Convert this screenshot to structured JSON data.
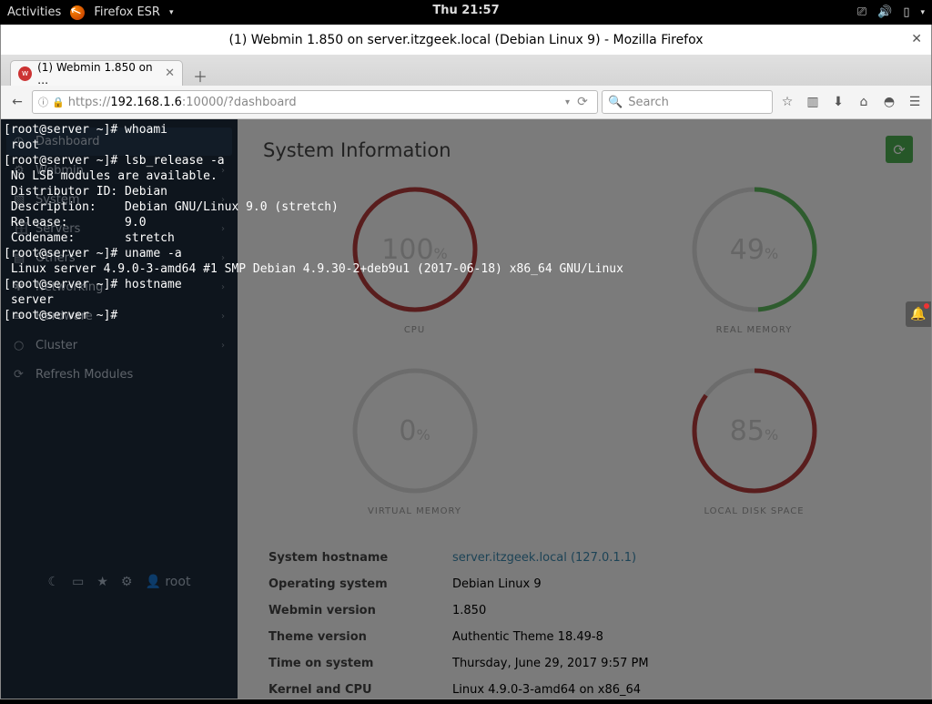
{
  "gnome": {
    "activities": "Activities",
    "app_name": "Firefox ESR",
    "clock": "Thu 21:57"
  },
  "firefox": {
    "window_title": "(1) Webmin 1.850 on server.itzgeek.local (Debian Linux 9) - Mozilla Firefox",
    "tab_title": "(1) Webmin 1.850 on …",
    "url": {
      "prefix": "https://",
      "host": "192.168.1.6",
      "suffix": ":10000/?dashboard"
    },
    "search_placeholder": "Search"
  },
  "sidebar": {
    "items": [
      {
        "icon": "◷",
        "label": "Dashboard",
        "chev": ""
      },
      {
        "icon": "⚙",
        "label": "Webmin",
        "chev": "›"
      },
      {
        "icon": "▧",
        "label": "System",
        "chev": "›"
      },
      {
        "icon": "🗄",
        "label": "Servers",
        "chev": "›"
      },
      {
        "icon": "▤",
        "label": "Others",
        "chev": "›"
      },
      {
        "icon": "✱",
        "label": "Networking",
        "chev": "›"
      },
      {
        "icon": "≡",
        "label": "Hardware",
        "chev": "›"
      },
      {
        "icon": "○",
        "label": "Cluster",
        "chev": "›"
      },
      {
        "icon": "⟳",
        "label": "Refresh Modules",
        "chev": ""
      }
    ],
    "user": "root"
  },
  "main": {
    "heading": "System Information",
    "gauges": {
      "cpu": {
        "value": "100",
        "suffix": "%",
        "label": "CPU",
        "stroke": "#b33a3a",
        "frac": 1.0
      },
      "mem": {
        "value": "49",
        "suffix": "%",
        "label": "REAL MEMORY",
        "stroke": "#5cb85c",
        "frac": 0.49
      },
      "vmem": {
        "value": "0",
        "suffix": "%",
        "label": "VIRTUAL MEMORY",
        "stroke": "#b33a3a",
        "frac": 0.0
      },
      "disk": {
        "value": "85",
        "suffix": "%",
        "label": "LOCAL DISK SPACE",
        "stroke": "#b33a3a",
        "frac": 0.85
      }
    },
    "info": [
      {
        "k": "System hostname",
        "v": "server.itzgeek.local (127.0.1.1)",
        "link": true
      },
      {
        "k": "Operating system",
        "v": "Debian Linux 9"
      },
      {
        "k": "Webmin version",
        "v": "1.850"
      },
      {
        "k": "Theme version",
        "v": "Authentic Theme 18.49-8"
      },
      {
        "k": "Time on system",
        "v": "Thursday, June 29, 2017 9:57 PM"
      },
      {
        "k": "Kernel and CPU",
        "v": "Linux 4.9.0-3-amd64 on x86_64"
      }
    ]
  },
  "terminal_lines": [
    "[root@server ~]# whoami",
    " root",
    "[root@server ~]# lsb_release -a",
    " No LSB modules are available.",
    " Distributor ID: Debian",
    " Description:    Debian GNU/Linux 9.0 (stretch)",
    " Release:        9.0",
    " Codename:       stretch",
    "[root@server ~]# uname -a",
    " Linux server 4.9.0-3-amd64 #1 SMP Debian 4.9.30-2+deb9u1 (2017-06-18) x86_64 GNU/Linux",
    "[root@server ~]# hostname",
    " server",
    "[root@server ~]# "
  ],
  "chart_data": [
    {
      "type": "gauge",
      "title": "CPU",
      "value": 100,
      "unit": "%",
      "range": [
        0,
        100
      ]
    },
    {
      "type": "gauge",
      "title": "REAL MEMORY",
      "value": 49,
      "unit": "%",
      "range": [
        0,
        100
      ]
    },
    {
      "type": "gauge",
      "title": "VIRTUAL MEMORY",
      "value": 0,
      "unit": "%",
      "range": [
        0,
        100
      ]
    },
    {
      "type": "gauge",
      "title": "LOCAL DISK SPACE",
      "value": 85,
      "unit": "%",
      "range": [
        0,
        100
      ]
    }
  ]
}
